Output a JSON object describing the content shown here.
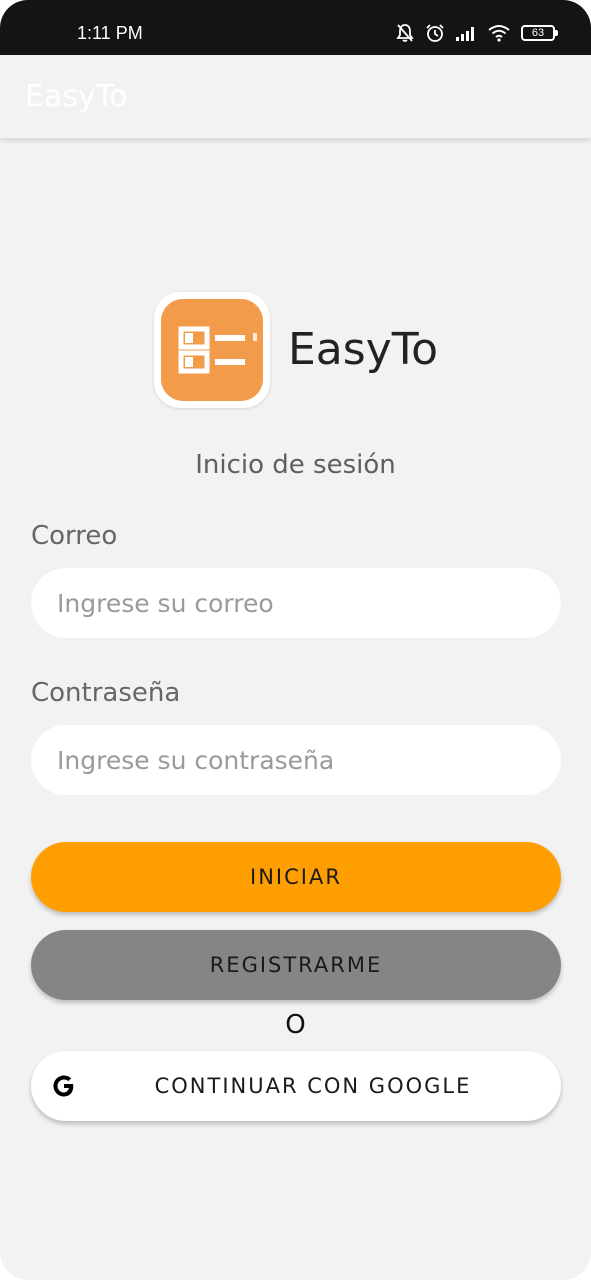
{
  "status_bar": {
    "time": "1:11 PM",
    "battery": "63",
    "icons": [
      "notifications-off-icon",
      "alarm-icon",
      "signal-icon",
      "wifi-icon",
      "battery-icon"
    ]
  },
  "app_bar": {
    "title": "EasyTo"
  },
  "logo": {
    "wordmark": "EasyTo",
    "icon": "list-logo-icon",
    "icon_color": "#f19b4b"
  },
  "login": {
    "subtitle": "Inicio de sesión",
    "email_label": "Correo",
    "email_value": "",
    "email_placeholder": "Ingrese su correo",
    "password_label": "Contraseña",
    "password_value": "",
    "password_placeholder": "Ingrese su contraseña",
    "start_button": "INICIAR",
    "register_button": "REGISTRARME",
    "or_text": "O",
    "google_button": "CONTINUAR CON GOOGLE",
    "google_icon": "google-icon"
  },
  "colors": {
    "primary": "#ff9e00",
    "secondary": "#858585",
    "background": "#f2f2f2",
    "status_bar": "#141414"
  }
}
